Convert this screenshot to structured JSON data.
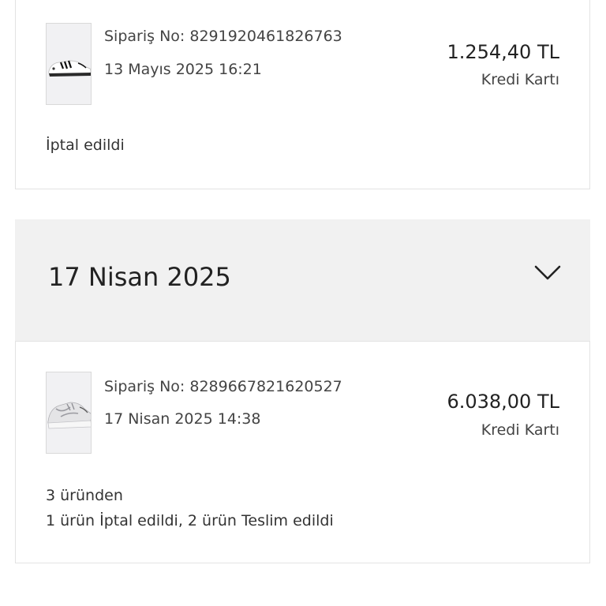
{
  "orders": [
    {
      "order_no": "Sipariş No: 8291920461826763",
      "date_time": "13 Mayıs 2025 16:21",
      "amount": "1.254,40 TL",
      "payment": "Kredi Kartı",
      "status": "İptal edildi"
    },
    {
      "order_no": "Sipariş No: 8289667821620527",
      "date_time": "17 Nisan 2025 14:38",
      "amount": "6.038,00 TL",
      "payment": "Kredi Kartı",
      "status_line1": "3 üründen",
      "status_line2": "1 ürün İptal edildi, 2 ürün Teslim edildi"
    }
  ],
  "date_group": {
    "title": "17 Nisan 2025",
    "toggle_icon": "chevron-down-icon"
  },
  "colors": {
    "header_bg": "#f1f1f1",
    "card_border": "#e3e3e3",
    "text": "#222222"
  }
}
